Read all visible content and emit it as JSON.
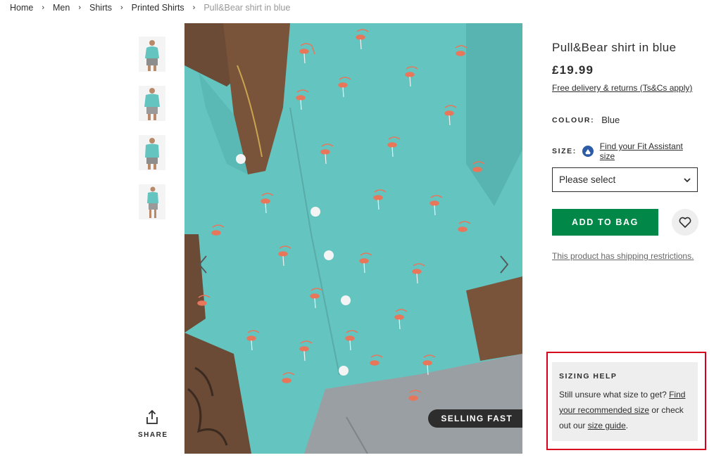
{
  "breadcrumb": {
    "items": [
      "Home",
      "Men",
      "Shirts",
      "Printed Shirts"
    ],
    "current": "Pull&Bear shirt in blue",
    "separator": "›"
  },
  "gallery": {
    "thumbnail_count": 4,
    "badge": "SELLING FAST",
    "share_label": "SHARE",
    "shirt_color": "#64c4c0"
  },
  "product": {
    "title": "Pull&Bear shirt in blue",
    "price": "£19.99",
    "delivery_link": "Free delivery & returns (Ts&Cs apply)",
    "colour_label": "COLOUR:",
    "colour_value": "Blue",
    "size_label": "SIZE:",
    "fit_assistant_link": "Find your Fit Assistant size",
    "size_select_value": "Please select",
    "add_to_bag": "ADD TO BAG",
    "shipping_note": "This product has shipping restrictions."
  },
  "sizing_help": {
    "heading": "SIZING HELP",
    "text_1": "Still unsure what size to get? ",
    "link_1": "Find your recommended size",
    "text_2": " or check out our ",
    "link_2": "size guide",
    "text_3": "."
  },
  "colors": {
    "add_button": "#018849",
    "highlight_outline": "#d6001c",
    "fit_icon": "#2d5ba6"
  }
}
